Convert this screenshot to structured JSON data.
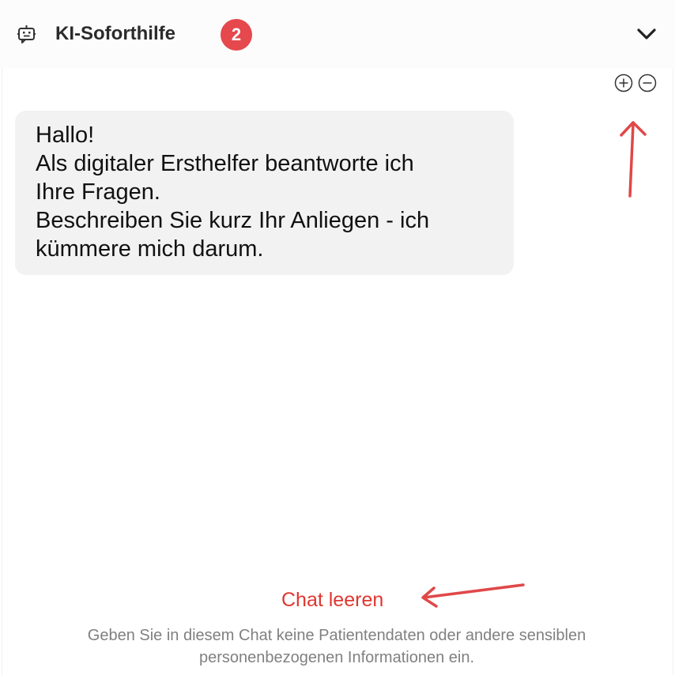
{
  "header": {
    "title": "KI-Soforthilfe",
    "badge_count": "2",
    "icons": {
      "assistant": "bot-chat-icon",
      "collapse": "chevron-down-icon"
    }
  },
  "zoom_controls": {
    "zoom_in_icon": "plus-circle-icon",
    "zoom_out_icon": "minus-circle-icon"
  },
  "messages": [
    {
      "sender": "assistant",
      "lines": [
        "Hallo!",
        "Als digitaler Ersthelfer beantworte ich",
        "Ihre Fragen.",
        "Beschreiben Sie kurz Ihr Anliegen - ich",
        "kümmere mich darum."
      ]
    }
  ],
  "footer": {
    "clear_label": "Chat leeren",
    "disclaimer_lines": [
      "Geben Sie in diesem Chat keine Patientendaten oder andere sensiblen",
      "personenbezogenen Informationen ein."
    ]
  },
  "colors": {
    "badge": "#e5484d",
    "clear_link": "#e0362f",
    "annotation_arrow": "#e04848",
    "bubble_background": "#f2f2f2",
    "disclaimer_text": "#808080"
  }
}
